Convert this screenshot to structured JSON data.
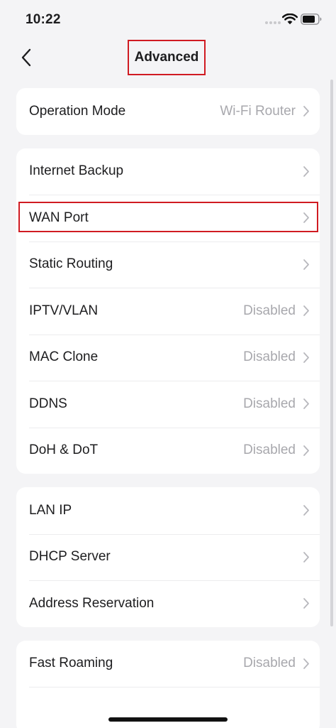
{
  "status_bar": {
    "time": "10:22",
    "icons": [
      "signal-dots-icon",
      "wifi-icon",
      "battery-icon"
    ]
  },
  "nav": {
    "back_icon": "chevron-left-icon",
    "title": "Advanced"
  },
  "groups": [
    {
      "items": [
        {
          "label": "Operation Mode",
          "value": "Wi-Fi Router"
        }
      ]
    },
    {
      "items": [
        {
          "label": "Internet Backup",
          "value": ""
        },
        {
          "label": "WAN Port",
          "value": "",
          "highlighted": true
        },
        {
          "label": "Static Routing",
          "value": ""
        },
        {
          "label": "IPTV/VLAN",
          "value": "Disabled"
        },
        {
          "label": "MAC Clone",
          "value": "Disabled"
        },
        {
          "label": "DDNS",
          "value": "Disabled"
        },
        {
          "label": "DoH & DoT",
          "value": "Disabled"
        }
      ]
    },
    {
      "items": [
        {
          "label": "LAN IP",
          "value": ""
        },
        {
          "label": "DHCP Server",
          "value": ""
        },
        {
          "label": "Address Reservation",
          "value": ""
        }
      ]
    },
    {
      "items": [
        {
          "label": "Fast Roaming",
          "value": "Disabled"
        },
        {
          "label": "",
          "value": ""
        }
      ]
    }
  ],
  "colors": {
    "background": "#f4f4f6",
    "card": "#ffffff",
    "text": "#1d1d1f",
    "secondary_text": "#a8a8ad",
    "highlight": "#d01b22"
  }
}
